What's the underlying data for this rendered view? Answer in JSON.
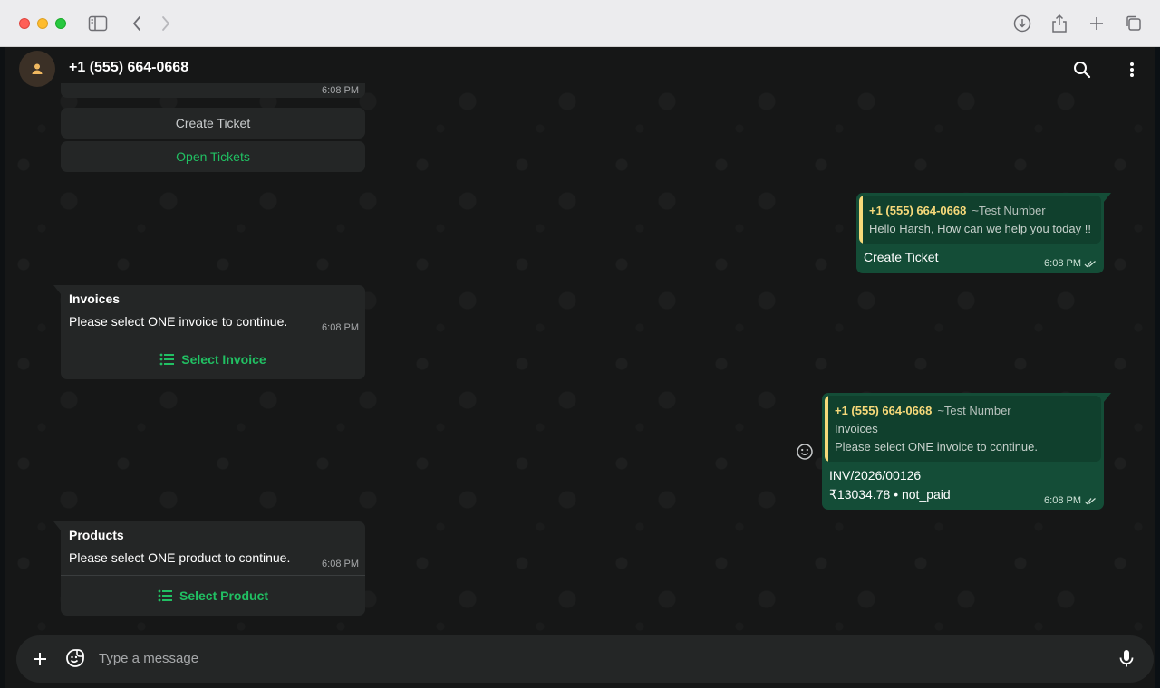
{
  "browser": {
    "icons": [
      "sidebar-icon",
      "back-icon",
      "forward-icon",
      "download-icon",
      "share-icon",
      "new-tab-icon",
      "tabs-overview-icon"
    ]
  },
  "header": {
    "contact_name": "+1 (555) 664-0668",
    "icons": [
      "avatar-person-icon",
      "search-icon",
      "more-vertical-icon"
    ]
  },
  "messages": {
    "top_truncated_time": "6:08 PM",
    "buttons": [
      {
        "label": "Create Ticket",
        "color": "#c9cccd"
      },
      {
        "label": "Open Tickets",
        "color": "#21c063"
      }
    ],
    "invoice_card": {
      "title": "Invoices",
      "body": "Please select ONE invoice to continue.",
      "time": "6:08 PM",
      "action": "Select Invoice"
    },
    "reply_create_ticket": {
      "quote_name": "+1 (555) 664-0668",
      "quote_sub": "~Test Number",
      "quote_text": "Hello Harsh, How can we help you today !!",
      "text": "Create Ticket",
      "time": "6:08 PM"
    },
    "reply_invoice": {
      "quote_name": "+1 (555) 664-0668",
      "quote_sub": "~Test Number",
      "quote_line1": "Invoices",
      "quote_line2": "Please select ONE invoice to continue.",
      "text_line1": "INV/2026/00126",
      "text_line2": "₹13034.78 • not_paid",
      "time": "6:08 PM"
    },
    "product_card": {
      "title": "Products",
      "body": "Please select ONE product to continue.",
      "time": "6:08 PM",
      "action": "Select Product"
    }
  },
  "composer": {
    "placeholder": "Type a message"
  },
  "colors": {
    "accent_green": "#21c063",
    "outgoing_bubble": "#144d37",
    "incoming_bubble": "#242626",
    "quote_name": "#f7d97a"
  }
}
